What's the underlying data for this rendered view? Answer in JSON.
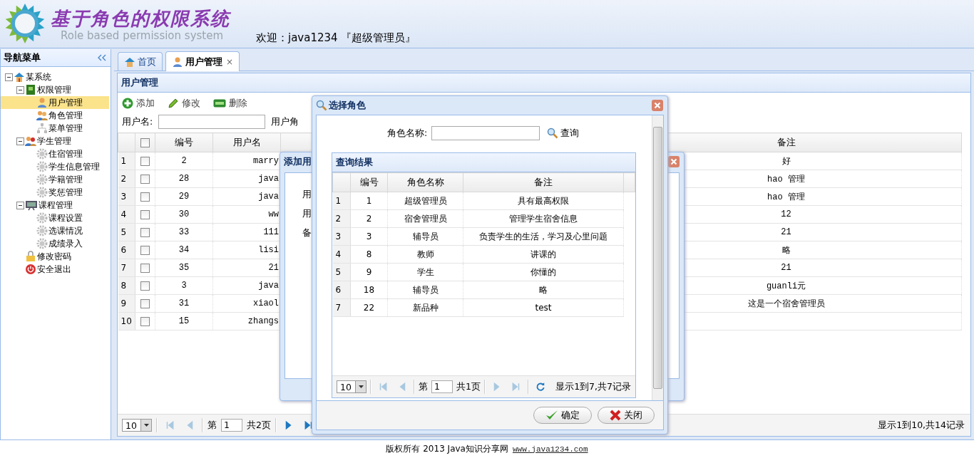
{
  "header": {
    "title": "基于角色的权限系统",
    "subtitle": "Role based permission system",
    "welcome": "欢迎：java1234 『超级管理员』"
  },
  "sidebar": {
    "title": "导航菜单"
  },
  "tree": [
    {
      "label": "某系统",
      "expanded": true,
      "selected": false,
      "children": [
        {
          "label": "权限管理",
          "expanded": true,
          "selected": false,
          "children": [
            {
              "label": "用户管理",
              "selected": true
            },
            {
              "label": "角色管理",
              "selected": false
            },
            {
              "label": "菜单管理",
              "selected": false
            }
          ]
        },
        {
          "label": "学生管理",
          "expanded": true,
          "selected": false,
          "children": [
            {
              "label": "住宿管理",
              "selected": false
            },
            {
              "label": "学生信息管理",
              "selected": false
            },
            {
              "label": "学籍管理",
              "selected": false
            },
            {
              "label": "奖惩管理",
              "selected": false
            }
          ]
        },
        {
          "label": "课程管理",
          "expanded": true,
          "selected": false,
          "children": [
            {
              "label": "课程设置",
              "selected": false
            },
            {
              "label": "选课情况",
              "selected": false
            },
            {
              "label": "成绩录入",
              "selected": false
            }
          ]
        },
        {
          "label": "修改密码",
          "selected": false
        },
        {
          "label": "安全退出",
          "selected": false
        }
      ]
    }
  ],
  "tabs": [
    {
      "label": "首页",
      "selected": false
    },
    {
      "label": "用户管理",
      "selected": true,
      "close": "×"
    }
  ],
  "panel": {
    "title": "用户管理",
    "toolbar": [
      {
        "label": "添加",
        "kind": "add"
      },
      {
        "label": "修改",
        "kind": "edit"
      },
      {
        "label": "删除",
        "kind": "delete"
      }
    ],
    "search": {
      "label": "用户名:",
      "role_label": "用户角"
    }
  },
  "table": {
    "columns": [
      "编号",
      "用户名",
      "备注"
    ],
    "header_checked": false,
    "rows": [
      {
        "num": "1",
        "checked": false,
        "id": "2",
        "username": "marry",
        "remark": "好"
      },
      {
        "num": "2",
        "checked": false,
        "id": "28",
        "username": "java",
        "remark": "hao 管理"
      },
      {
        "num": "3",
        "checked": false,
        "id": "29",
        "username": "java",
        "remark": "hao 管理"
      },
      {
        "num": "4",
        "checked": false,
        "id": "30",
        "username": "ww",
        "remark": "12"
      },
      {
        "num": "5",
        "checked": false,
        "id": "33",
        "username": "111",
        "remark": "21"
      },
      {
        "num": "6",
        "checked": false,
        "id": "34",
        "username": "lisi",
        "remark": "略"
      },
      {
        "num": "7",
        "checked": false,
        "id": "35",
        "username": "21",
        "remark": "21"
      },
      {
        "num": "8",
        "checked": false,
        "id": "3",
        "username": "java",
        "remark": "guanli元"
      },
      {
        "num": "9",
        "checked": false,
        "id": "31",
        "username": "xiaol",
        "remark": "这是一个宿舍管理员"
      },
      {
        "num": "10",
        "checked": false,
        "id": "15",
        "username": "zhangs"
      }
    ]
  },
  "pager": {
    "page_size": "10",
    "before": "第",
    "page": "1",
    "after": "共2页",
    "summary": "显示1到10,共14记录",
    "nav": [
      {
        "kind": "first",
        "disabled": true
      },
      {
        "kind": "prev",
        "disabled": true
      },
      {
        "kind": "next",
        "disabled": false
      },
      {
        "kind": "last",
        "disabled": false
      }
    ]
  },
  "footer": {
    "copyright": "版权所有 2013 Java知识分享网",
    "link": "www.java1234.com"
  },
  "add_dialog": {
    "title": "添加用",
    "labels": [
      "用",
      "用",
      "备"
    ]
  },
  "role_dialog": {
    "title": "选择角色",
    "search_label": "角色名称:",
    "search_button": "查询",
    "results": {
      "title": "查询结果",
      "columns": [
        "编号",
        "角色名称",
        "备注"
      ],
      "rows": [
        {
          "num": "1",
          "id": "1",
          "name": "超级管理员",
          "remark": "具有最高权限"
        },
        {
          "num": "2",
          "id": "2",
          "name": "宿舍管理员",
          "remark": "管理学生宿舍信息"
        },
        {
          "num": "3",
          "id": "3",
          "name": "辅导员",
          "remark": "负责学生的生活，学习及心里问题"
        },
        {
          "num": "4",
          "id": "8",
          "name": "教师",
          "remark": "讲课的"
        },
        {
          "num": "5",
          "id": "9",
          "name": "学生",
          "remark": "你懂的"
        },
        {
          "num": "6",
          "id": "18",
          "name": "辅导员",
          "remark": "略"
        },
        {
          "num": "7",
          "id": "22",
          "name": "新品种",
          "remark": "test"
        }
      ]
    },
    "pager": {
      "page_size": "10",
      "before": "第",
      "page": "1",
      "after": "共1页",
      "summary": "显示1到7,共7记录",
      "nav": [
        {
          "kind": "first",
          "disabled": true
        },
        {
          "kind": "prev",
          "disabled": true
        },
        {
          "kind": "next",
          "disabled": true
        },
        {
          "kind": "last",
          "disabled": true
        },
        {
          "kind": "refresh",
          "disabled": false
        }
      ]
    },
    "buttons": [
      {
        "label": "确定",
        "kind": "ok"
      },
      {
        "label": "关闭",
        "kind": "close"
      }
    ]
  }
}
